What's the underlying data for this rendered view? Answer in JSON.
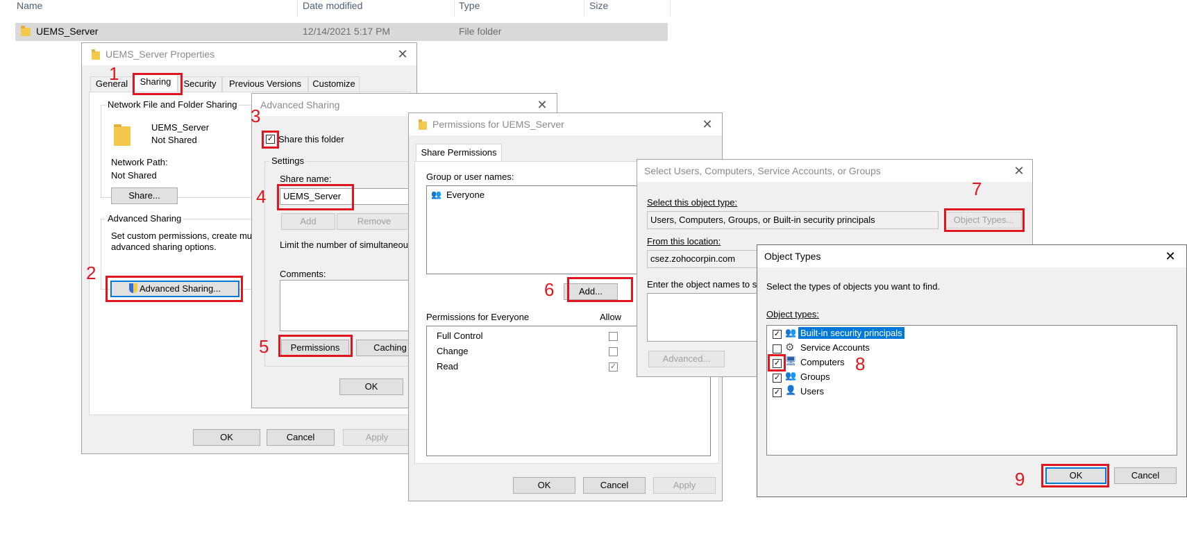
{
  "explorer": {
    "columns": [
      "Name",
      "Date modified",
      "Type",
      "Size"
    ],
    "row": {
      "name": "UEMS_Server",
      "date": "12/14/2021 5:17 PM",
      "type": "File folder",
      "size": ""
    }
  },
  "properties": {
    "title": "UEMS_Server Properties",
    "tabs": [
      "General",
      "Sharing",
      "Security",
      "Previous Versions",
      "Customize"
    ],
    "network_group": "Network File and Folder Sharing",
    "folder_name": "UEMS_Server",
    "folder_status": "Not Shared",
    "network_path_label": "Network Path:",
    "network_path_value": "Not Shared",
    "share_button": "Share...",
    "advanced_group": "Advanced Sharing",
    "advanced_desc1": "Set custom permissions, create mu",
    "advanced_desc2": "advanced sharing options.",
    "advanced_button": "Advanced Sharing...",
    "ok": "OK",
    "cancel": "Cancel",
    "apply": "Apply"
  },
  "advanced": {
    "title": "Advanced Sharing",
    "share_checkbox": "Share this folder",
    "settings_group": "Settings",
    "share_name_label": "Share name:",
    "share_name_value": "UEMS_Server",
    "add": "Add",
    "remove": "Remove",
    "limit_label": "Limit the number of simultaneou",
    "comments_label": "Comments:",
    "permissions": "Permissions",
    "caching": "Caching",
    "ok": "OK"
  },
  "permissions": {
    "title": "Permissions for UEMS_Server",
    "tab": "Share Permissions",
    "group_label": "Group or user names:",
    "users": [
      "Everyone"
    ],
    "add": "Add...",
    "perm_label": "Permissions for Everyone",
    "allow_header": "Allow",
    "rows": [
      {
        "name": "Full Control",
        "allow": false
      },
      {
        "name": "Change",
        "allow": false
      },
      {
        "name": "Read",
        "allow": true
      }
    ],
    "ok": "OK",
    "cancel": "Cancel",
    "apply": "Apply"
  },
  "select_users": {
    "title": "Select Users, Computers, Service Accounts, or Groups",
    "object_type_label": "Select this object type:",
    "object_type_value": "Users, Computers, Groups, or Built-in security principals",
    "object_types_button": "Object Types...",
    "location_label": "From this location:",
    "location_value": "csez.zohocorpin.com",
    "enter_label": "Enter the object names to s",
    "advanced_button": "Advanced..."
  },
  "object_types": {
    "title": "Object Types",
    "desc": "Select the types of objects you want to find.",
    "list_label": "Object types:",
    "items": [
      {
        "label": "Built-in security principals",
        "checked": true,
        "icon": "security-principals-icon"
      },
      {
        "label": "Service Accounts",
        "checked": false,
        "icon": "service-accounts-icon"
      },
      {
        "label": "Computers",
        "checked": true,
        "icon": "computer-icon"
      },
      {
        "label": "Groups",
        "checked": true,
        "icon": "groups-icon"
      },
      {
        "label": "Users",
        "checked": true,
        "icon": "user-icon"
      }
    ],
    "ok": "OK",
    "cancel": "Cancel"
  },
  "steps": [
    "1",
    "2",
    "3",
    "4",
    "5",
    "6",
    "7",
    "8",
    "9"
  ],
  "colors": {
    "annotation": "#e0161e",
    "selection": "#0078d7",
    "folder": "#f2c94c"
  }
}
